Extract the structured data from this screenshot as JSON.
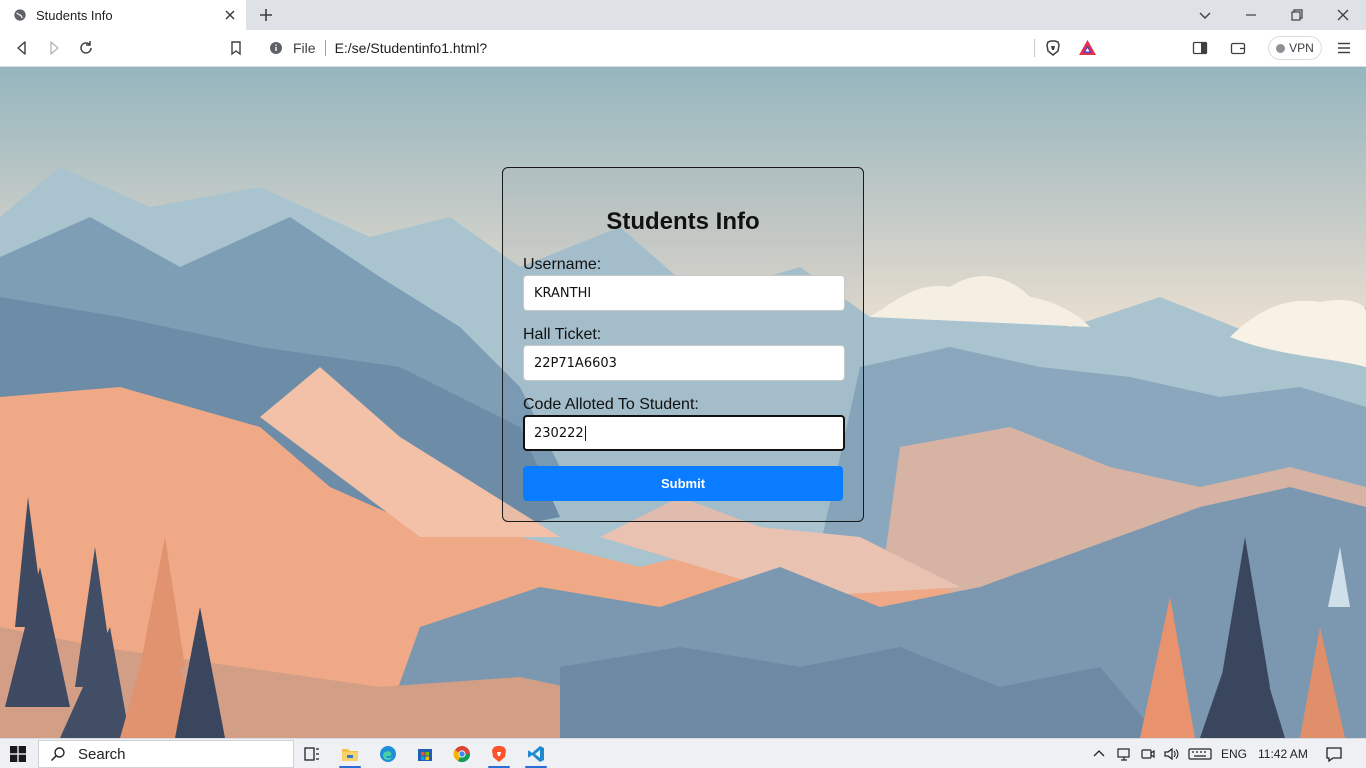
{
  "browser": {
    "tab_title": "Students Info",
    "scheme_label": "File",
    "url": "E:/se/Studentinfo1.html?",
    "vpn_label": "VPN"
  },
  "form": {
    "title": "Students Info",
    "fields": [
      {
        "label": "Username:",
        "value": "KRANTHI"
      },
      {
        "label": "Hall Ticket:",
        "value": "22P71A6603"
      },
      {
        "label": "Code Alloted To Student:",
        "value": "230222"
      }
    ],
    "submit_label": "Submit"
  },
  "taskbar": {
    "search_placeholder": "Search",
    "language": "ENG",
    "time": "11:42 AM",
    "apps": [
      "task-view",
      "file-explorer",
      "edge",
      "microsoft-store",
      "chrome",
      "brave",
      "vscode"
    ]
  },
  "colors": {
    "submit_button": "#0a7cff",
    "brave_orange": "#fb542b"
  }
}
